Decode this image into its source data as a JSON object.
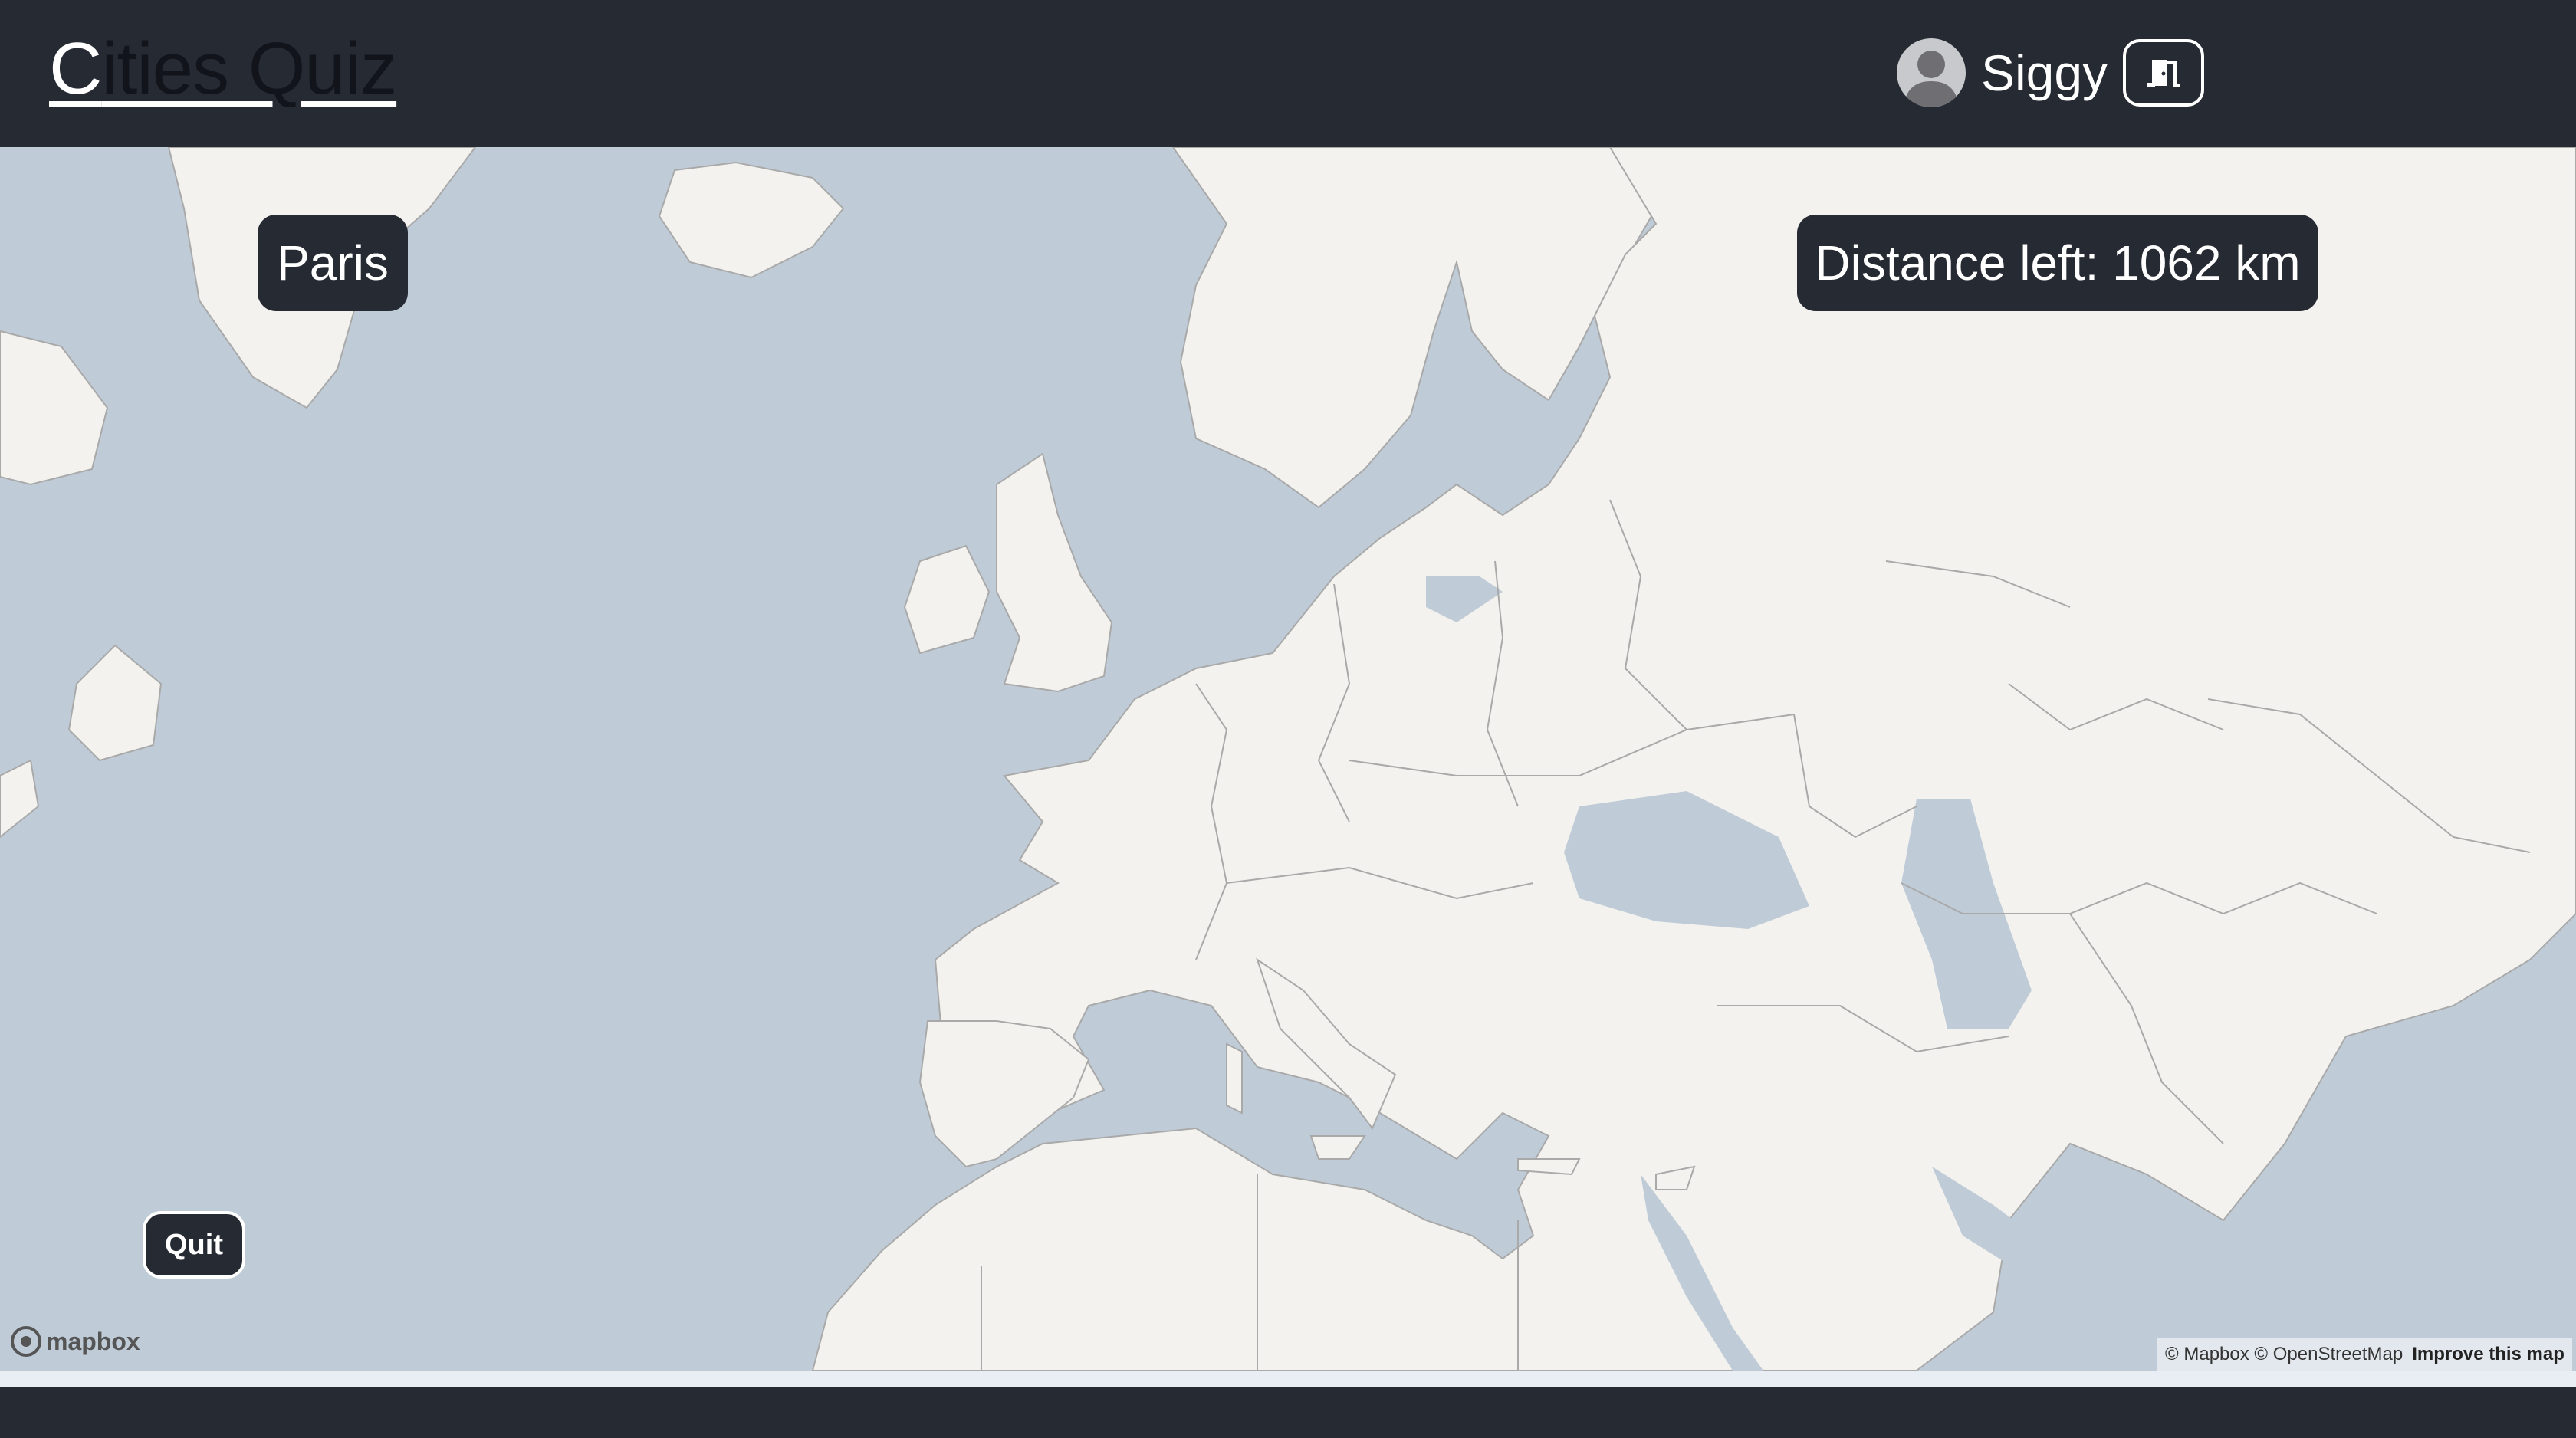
{
  "header": {
    "title_first": "C",
    "title_rest": "ities Quiz",
    "user_name": "Siggy",
    "logout_icon": "door-exit-icon"
  },
  "game": {
    "target_city": "Paris",
    "distance_left": "Distance left: 1062 km",
    "quit_label": "Quit"
  },
  "map": {
    "logo_text": "mapbox",
    "attribution_text": "© Mapbox © OpenStreetMap",
    "improve_link": "Improve this map",
    "colors": {
      "water": "#bfccd8",
      "land": "#f3f2ee",
      "border": "#a9a9a9",
      "ui": "#262a33"
    }
  }
}
